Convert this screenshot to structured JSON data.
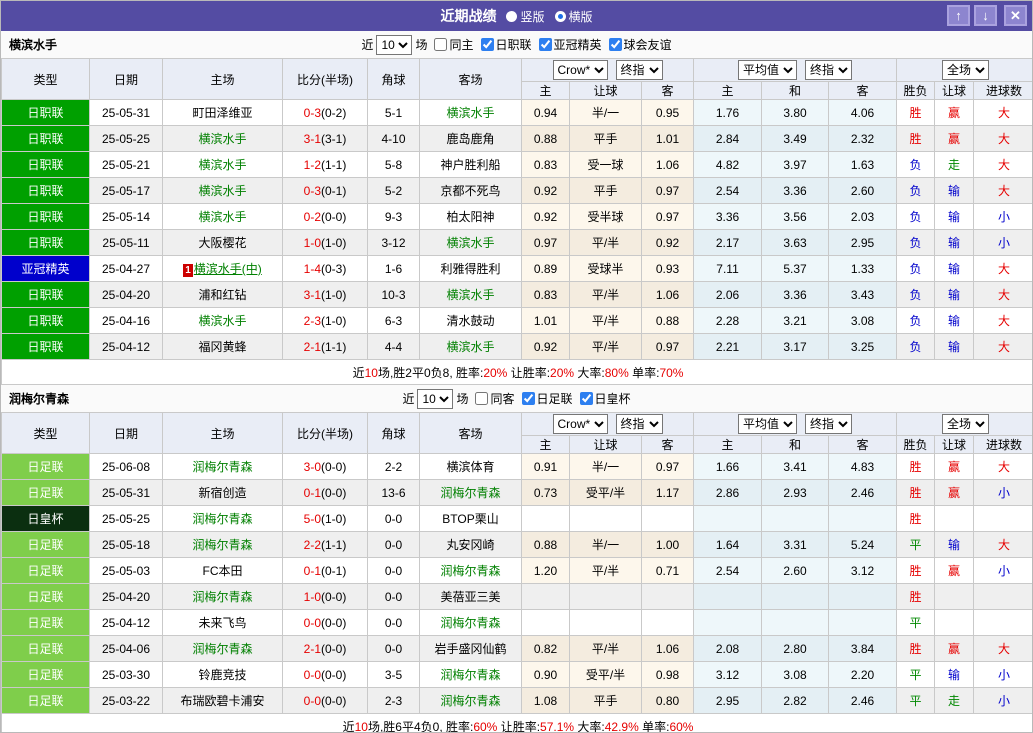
{
  "titlebar": {
    "title": "近期战绩",
    "vertical_label": "竖版",
    "horizontal_label": "横版",
    "selected": "横版",
    "up_glyph": "↑",
    "down_glyph": "↓",
    "close_glyph": "✕"
  },
  "columns": {
    "type": "类型",
    "date": "日期",
    "home": "主场",
    "score": "比分(半场)",
    "corner": "角球",
    "away": "客场",
    "odds_home": "主",
    "odds_handicap": "让球",
    "odds_away": "客",
    "avg_home": "主",
    "avg_draw": "和",
    "avg_away": "客",
    "result_wdl": "胜负",
    "result_handicap": "让球",
    "result_goals": "进球数"
  },
  "dropdowns": {
    "bookmaker": "Crow*",
    "final": "终指",
    "average": "平均值",
    "final2": "终指",
    "scope": "全场"
  },
  "colors": {
    "titlebar": "#544ca3",
    "league_green": "#00a000",
    "league_blue": "#0000cc",
    "league_light_green": "#7fce4b",
    "league_dark_green": "#0b2f10",
    "team_name": "#008000",
    "win_red": "#e60000",
    "lose_blue": "#0000cc",
    "draw_green": "#008800"
  },
  "sections": [
    {
      "team": "横滨水手",
      "filter": {
        "near_label": "近",
        "games_value": "10",
        "games_label": "场",
        "checkboxes": [
          {
            "label": "同主",
            "checked": false
          },
          {
            "label": "日职联",
            "checked": true
          },
          {
            "label": "亚冠精英",
            "checked": true
          },
          {
            "label": "球会友谊",
            "checked": true
          }
        ]
      },
      "rows": [
        {
          "league": "日职联",
          "league_type": "jl",
          "date": "25-05-31",
          "home": "町田泽维亚",
          "home_team": false,
          "score": "0-3",
          "half": "(0-2)",
          "corner": "5-1",
          "away": "横滨水手",
          "away_team": true,
          "o1": "0.94",
          "o2": "半/一",
          "o3": "0.95",
          "a1": "1.76",
          "a2": "3.80",
          "a3": "4.06",
          "r1": "胜",
          "r1c": "win",
          "r2": "赢",
          "r2c": "win",
          "r3": "大",
          "r3c": "over"
        },
        {
          "league": "日职联",
          "league_type": "jl",
          "date": "25-05-25",
          "home": "横滨水手",
          "home_team": true,
          "score": "3-1",
          "half": "(3-1)",
          "corner": "4-10",
          "away": "鹿岛鹿角",
          "away_team": false,
          "o1": "0.88",
          "o2": "平手",
          "o3": "1.01",
          "a1": "2.84",
          "a2": "3.49",
          "a3": "2.32",
          "r1": "胜",
          "r1c": "win",
          "r2": "赢",
          "r2c": "win",
          "r3": "大",
          "r3c": "over"
        },
        {
          "league": "日职联",
          "league_type": "jl",
          "date": "25-05-21",
          "home": "横滨水手",
          "home_team": true,
          "score": "1-2",
          "half": "(1-1)",
          "corner": "5-8",
          "away": "神户胜利船",
          "away_team": false,
          "o1": "0.83",
          "o2": "受一球",
          "o3": "1.06",
          "a1": "4.82",
          "a2": "3.97",
          "a3": "1.63",
          "r1": "负",
          "r1c": "lose",
          "r2": "走",
          "r2c": "push",
          "r3": "大",
          "r3c": "over"
        },
        {
          "league": "日职联",
          "league_type": "jl",
          "date": "25-05-17",
          "home": "横滨水手",
          "home_team": true,
          "score": "0-3",
          "half": "(0-1)",
          "corner": "5-2",
          "away": "京都不死鸟",
          "away_team": false,
          "o1": "0.92",
          "o2": "平手",
          "o3": "0.97",
          "a1": "2.54",
          "a2": "3.36",
          "a3": "2.60",
          "r1": "负",
          "r1c": "lose",
          "r2": "输",
          "r2c": "lose",
          "r3": "大",
          "r3c": "over"
        },
        {
          "league": "日职联",
          "league_type": "jl",
          "date": "25-05-14",
          "home": "横滨水手",
          "home_team": true,
          "score": "0-2",
          "half": "(0-0)",
          "corner": "9-3",
          "away": "柏太阳神",
          "away_team": false,
          "o1": "0.92",
          "o2": "受半球",
          "o3": "0.97",
          "a1": "3.36",
          "a2": "3.56",
          "a3": "2.03",
          "r1": "负",
          "r1c": "lose",
          "r2": "输",
          "r2c": "lose",
          "r3": "小",
          "r3c": "under"
        },
        {
          "league": "日职联",
          "league_type": "jl",
          "date": "25-05-11",
          "home": "大阪樱花",
          "home_team": false,
          "score": "1-0",
          "half": "(1-0)",
          "corner": "3-12",
          "away": "横滨水手",
          "away_team": true,
          "o1": "0.97",
          "o2": "平/半",
          "o3": "0.92",
          "a1": "2.17",
          "a2": "3.63",
          "a3": "2.95",
          "r1": "负",
          "r1c": "lose",
          "r2": "输",
          "r2c": "lose",
          "r3": "小",
          "r3c": "under"
        },
        {
          "league": "亚冠精英",
          "league_type": "acl",
          "date": "25-04-27",
          "home": "横滨水手(中)",
          "home_team": true,
          "home_badge": "1",
          "home_link": true,
          "score": "1-4",
          "half": "(0-3)",
          "corner": "1-6",
          "away": "利雅得胜利",
          "away_team": false,
          "o1": "0.89",
          "o2": "受球半",
          "o3": "0.93",
          "a1": "7.11",
          "a2": "5.37",
          "a3": "1.33",
          "r1": "负",
          "r1c": "lose",
          "r2": "输",
          "r2c": "lose",
          "r3": "大",
          "r3c": "over"
        },
        {
          "league": "日职联",
          "league_type": "jl",
          "date": "25-04-20",
          "home": "浦和红钻",
          "home_team": false,
          "score": "3-1",
          "half": "(1-0)",
          "corner": "10-3",
          "away": "横滨水手",
          "away_team": true,
          "o1": "0.83",
          "o2": "平/半",
          "o3": "1.06",
          "a1": "2.06",
          "a2": "3.36",
          "a3": "3.43",
          "r1": "负",
          "r1c": "lose",
          "r2": "输",
          "r2c": "lose",
          "r3": "大",
          "r3c": "over"
        },
        {
          "league": "日职联",
          "league_type": "jl",
          "date": "25-04-16",
          "home": "横滨水手",
          "home_team": true,
          "score": "2-3",
          "half": "(1-0)",
          "corner": "6-3",
          "away": "清水鼓动",
          "away_team": false,
          "o1": "1.01",
          "o2": "平/半",
          "o3": "0.88",
          "a1": "2.28",
          "a2": "3.21",
          "a3": "3.08",
          "r1": "负",
          "r1c": "lose",
          "r2": "输",
          "r2c": "lose",
          "r3": "大",
          "r3c": "over"
        },
        {
          "league": "日职联",
          "league_type": "jl",
          "date": "25-04-12",
          "home": "福冈黄蜂",
          "home_team": false,
          "score": "2-1",
          "half": "(1-1)",
          "corner": "4-4",
          "away": "横滨水手",
          "away_team": true,
          "o1": "0.92",
          "o2": "平/半",
          "o3": "0.97",
          "a1": "2.21",
          "a2": "3.17",
          "a3": "3.25",
          "r1": "负",
          "r1c": "lose",
          "r2": "输",
          "r2c": "lose",
          "r3": "大",
          "r3c": "over"
        }
      ],
      "summary": [
        {
          "t": "近"
        },
        {
          "t": "10",
          "red": true
        },
        {
          "t": "场,胜2平0负8, 胜率:"
        },
        {
          "t": "20%",
          "red": true
        },
        {
          "t": " 让胜率:"
        },
        {
          "t": "20%",
          "red": true
        },
        {
          "t": " 大率:"
        },
        {
          "t": "80%",
          "red": true
        },
        {
          "t": " 单率:"
        },
        {
          "t": "70%",
          "red": true
        }
      ]
    },
    {
      "team": "润梅尔青森",
      "filter": {
        "near_label": "近",
        "games_value": "10",
        "games_label": "场",
        "checkboxes": [
          {
            "label": "同客",
            "checked": false
          },
          {
            "label": "日足联",
            "checked": true
          },
          {
            "label": "日皇杯",
            "checked": true
          }
        ]
      },
      "rows": [
        {
          "league": "日足联",
          "league_type": "jfl",
          "date": "25-06-08",
          "home": "润梅尔青森",
          "home_team": true,
          "score": "3-0",
          "half": "(0-0)",
          "corner": "2-2",
          "away": "横滨体育",
          "away_team": false,
          "o1": "0.91",
          "o2": "半/一",
          "o3": "0.97",
          "a1": "1.66",
          "a2": "3.41",
          "a3": "4.83",
          "r1": "胜",
          "r1c": "win",
          "r2": "赢",
          "r2c": "win",
          "r3": "大",
          "r3c": "over"
        },
        {
          "league": "日足联",
          "league_type": "jfl",
          "date": "25-05-31",
          "home": "新宿创造",
          "home_team": false,
          "score": "0-1",
          "half": "(0-0)",
          "corner": "13-6",
          "away": "润梅尔青森",
          "away_team": true,
          "o1": "0.73",
          "o2": "受平/半",
          "o3": "1.17",
          "a1": "2.86",
          "a2": "2.93",
          "a3": "2.46",
          "r1": "胜",
          "r1c": "win",
          "r2": "赢",
          "r2c": "win",
          "r3": "小",
          "r3c": "under"
        },
        {
          "league": "日皇杯",
          "league_type": "emp",
          "date": "25-05-25",
          "home": "润梅尔青森",
          "home_team": true,
          "score": "5-0",
          "half": "(1-0)",
          "corner": "0-0",
          "away": "BTOP栗山",
          "away_team": false,
          "o1": "",
          "o2": "",
          "o3": "",
          "a1": "",
          "a2": "",
          "a3": "",
          "r1": "胜",
          "r1c": "win",
          "r2": "",
          "r2c": "",
          "r3": "",
          "r3c": ""
        },
        {
          "league": "日足联",
          "league_type": "jfl",
          "date": "25-05-18",
          "home": "润梅尔青森",
          "home_team": true,
          "score": "2-2",
          "half": "(1-1)",
          "corner": "0-0",
          "away": "丸安冈崎",
          "away_team": false,
          "o1": "0.88",
          "o2": "半/一",
          "o3": "1.00",
          "a1": "1.64",
          "a2": "3.31",
          "a3": "5.24",
          "r1": "平",
          "r1c": "draw",
          "r2": "输",
          "r2c": "lose",
          "r3": "大",
          "r3c": "over"
        },
        {
          "league": "日足联",
          "league_type": "jfl",
          "date": "25-05-03",
          "home": "FC本田",
          "home_team": false,
          "score": "0-1",
          "half": "(0-1)",
          "corner": "0-0",
          "away": "润梅尔青森",
          "away_team": true,
          "o1": "1.20",
          "o2": "平/半",
          "o3": "0.71",
          "a1": "2.54",
          "a2": "2.60",
          "a3": "3.12",
          "r1": "胜",
          "r1c": "win",
          "r2": "赢",
          "r2c": "win",
          "r3": "小",
          "r3c": "under"
        },
        {
          "league": "日足联",
          "league_type": "jfl",
          "date": "25-04-20",
          "home": "润梅尔青森",
          "home_team": true,
          "score": "1-0",
          "half": "(0-0)",
          "corner": "0-0",
          "away": "美蓓亚三美",
          "away_team": false,
          "o1": "",
          "o2": "",
          "o3": "",
          "a1": "",
          "a2": "",
          "a3": "",
          "r1": "胜",
          "r1c": "win",
          "r2": "",
          "r2c": "",
          "r3": "",
          "r3c": ""
        },
        {
          "league": "日足联",
          "league_type": "jfl",
          "date": "25-04-12",
          "home": "未来飞鸟",
          "home_team": false,
          "score": "0-0",
          "half": "(0-0)",
          "corner": "0-0",
          "away": "润梅尔青森",
          "away_team": true,
          "o1": "",
          "o2": "",
          "o3": "",
          "a1": "",
          "a2": "",
          "a3": "",
          "r1": "平",
          "r1c": "draw",
          "r2": "",
          "r2c": "",
          "r3": "",
          "r3c": ""
        },
        {
          "league": "日足联",
          "league_type": "jfl",
          "date": "25-04-06",
          "home": "润梅尔青森",
          "home_team": true,
          "score": "2-1",
          "half": "(0-0)",
          "corner": "0-0",
          "away": "岩手盛冈仙鹤",
          "away_team": false,
          "o1": "0.82",
          "o2": "平/半",
          "o3": "1.06",
          "a1": "2.08",
          "a2": "2.80",
          "a3": "3.84",
          "r1": "胜",
          "r1c": "win",
          "r2": "赢",
          "r2c": "win",
          "r3": "大",
          "r3c": "over"
        },
        {
          "league": "日足联",
          "league_type": "jfl",
          "date": "25-03-30",
          "home": "铃鹿竞技",
          "home_team": false,
          "score": "0-0",
          "half": "(0-0)",
          "corner": "3-5",
          "away": "润梅尔青森",
          "away_team": true,
          "o1": "0.90",
          "o2": "受平/半",
          "o3": "0.98",
          "a1": "3.12",
          "a2": "3.08",
          "a3": "2.20",
          "r1": "平",
          "r1c": "draw",
          "r2": "输",
          "r2c": "lose",
          "r3": "小",
          "r3c": "under"
        },
        {
          "league": "日足联",
          "league_type": "jfl",
          "date": "25-03-22",
          "home": "布瑞欧碧卡浦安",
          "home_team": false,
          "score": "0-0",
          "half": "(0-0)",
          "corner": "2-3",
          "away": "润梅尔青森",
          "away_team": true,
          "o1": "1.08",
          "o2": "平手",
          "o3": "0.80",
          "a1": "2.95",
          "a2": "2.82",
          "a3": "2.46",
          "r1": "平",
          "r1c": "draw",
          "r2": "走",
          "r2c": "push",
          "r3": "小",
          "r3c": "under"
        }
      ],
      "summary": [
        {
          "t": "近"
        },
        {
          "t": "10",
          "red": true
        },
        {
          "t": "场,胜6平4负0, 胜率:"
        },
        {
          "t": "60%",
          "red": true
        },
        {
          "t": " 让胜率:"
        },
        {
          "t": "57.1%",
          "red": true
        },
        {
          "t": " 大率:"
        },
        {
          "t": "42.9%",
          "red": true
        },
        {
          "t": " 单率:"
        },
        {
          "t": "60%",
          "red": true
        }
      ]
    }
  ]
}
